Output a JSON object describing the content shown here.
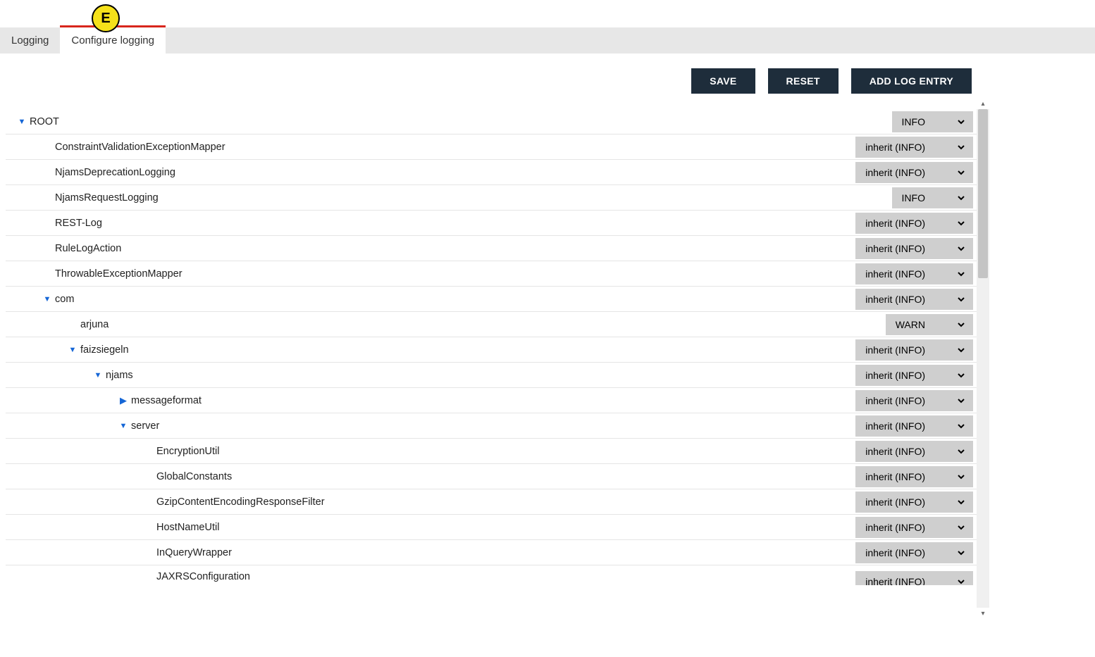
{
  "annotation_badge": "E",
  "tabs": {
    "logging": "Logging",
    "configure": "Configure logging"
  },
  "toolbar": {
    "save": "SAVE",
    "reset": "RESET",
    "add": "ADD LOG ENTRY"
  },
  "tree": [
    {
      "indent": 0,
      "toggle": "down",
      "label": "ROOT",
      "level": "INFO",
      "narrow": true
    },
    {
      "indent": 1,
      "toggle": "",
      "label": "ConstraintValidationExceptionMapper",
      "level": "inherit (INFO)"
    },
    {
      "indent": 1,
      "toggle": "",
      "label": "NjamsDeprecationLogging",
      "level": "inherit (INFO)"
    },
    {
      "indent": 1,
      "toggle": "",
      "label": "NjamsRequestLogging",
      "level": "INFO",
      "narrow": true
    },
    {
      "indent": 1,
      "toggle": "",
      "label": "REST-Log",
      "level": "inherit (INFO)"
    },
    {
      "indent": 1,
      "toggle": "",
      "label": "RuleLogAction",
      "level": "inherit (INFO)"
    },
    {
      "indent": 1,
      "toggle": "",
      "label": "ThrowableExceptionMapper",
      "level": "inherit (INFO)"
    },
    {
      "indent": 1,
      "toggle": "down",
      "label": "com",
      "level": "inherit (INFO)"
    },
    {
      "indent": 2,
      "toggle": "",
      "label": "arjuna",
      "level": "WARN",
      "narrow": true
    },
    {
      "indent": 2,
      "toggle": "down",
      "label": "faizsiegeln",
      "level": "inherit (INFO)"
    },
    {
      "indent": 3,
      "toggle": "down",
      "label": "njams",
      "level": "inherit (INFO)"
    },
    {
      "indent": 4,
      "toggle": "right",
      "label": "messageformat",
      "level": "inherit (INFO)"
    },
    {
      "indent": 4,
      "toggle": "down",
      "label": "server",
      "level": "inherit (INFO)"
    },
    {
      "indent": 5,
      "toggle": "",
      "label": "EncryptionUtil",
      "level": "inherit (INFO)"
    },
    {
      "indent": 5,
      "toggle": "",
      "label": "GlobalConstants",
      "level": "inherit (INFO)"
    },
    {
      "indent": 5,
      "toggle": "",
      "label": "GzipContentEncodingResponseFilter",
      "level": "inherit (INFO)"
    },
    {
      "indent": 5,
      "toggle": "",
      "label": "HostNameUtil",
      "level": "inherit (INFO)"
    },
    {
      "indent": 5,
      "toggle": "",
      "label": "InQueryWrapper",
      "level": "inherit (INFO)"
    },
    {
      "indent": 5,
      "toggle": "",
      "label": "JAXRSConfiguration",
      "level": "inherit (INFO)",
      "cut": true
    }
  ],
  "glyph": {
    "down": "▼",
    "right": "▶",
    "chev": "⌄"
  }
}
